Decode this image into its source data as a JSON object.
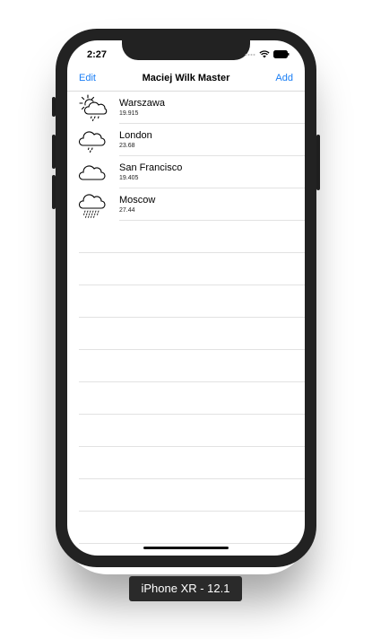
{
  "status": {
    "time": "2:27"
  },
  "nav": {
    "left": "Edit",
    "title": "Maciej Wilk Master",
    "right": "Add"
  },
  "cities": [
    {
      "name": "Warszawa",
      "temp": "19.915",
      "icon": "sun-cloud-drizzle-icon"
    },
    {
      "name": "London",
      "temp": "23.68",
      "icon": "cloud-drizzle-icon"
    },
    {
      "name": "San Francisco",
      "temp": "19.405",
      "icon": "cloud-icon"
    },
    {
      "name": "Moscow",
      "temp": "27.44",
      "icon": "cloud-rain-icon"
    }
  ],
  "device_label": "iPhone XR - 12.1"
}
